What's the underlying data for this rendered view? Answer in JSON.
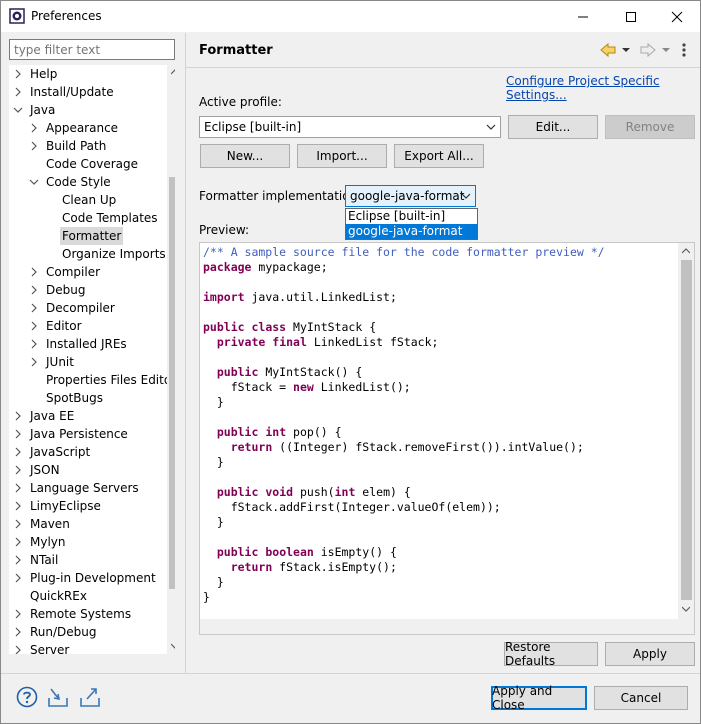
{
  "window": {
    "title": "Preferences"
  },
  "left": {
    "filter_placeholder": "type filter text",
    "tree": [
      {
        "label": "Help",
        "level": 0,
        "twisty": "closed"
      },
      {
        "label": "Install/Update",
        "level": 0,
        "twisty": "closed"
      },
      {
        "label": "Java",
        "level": 0,
        "twisty": "open"
      },
      {
        "label": "Appearance",
        "level": 1,
        "twisty": "closed"
      },
      {
        "label": "Build Path",
        "level": 1,
        "twisty": "closed"
      },
      {
        "label": "Code Coverage",
        "level": 1,
        "twisty": "none"
      },
      {
        "label": "Code Style",
        "level": 1,
        "twisty": "open"
      },
      {
        "label": "Clean Up",
        "level": 2,
        "twisty": "none"
      },
      {
        "label": "Code Templates",
        "level": 2,
        "twisty": "none"
      },
      {
        "label": "Formatter",
        "level": 2,
        "twisty": "none",
        "selected": true
      },
      {
        "label": "Organize Imports",
        "level": 2,
        "twisty": "none"
      },
      {
        "label": "Compiler",
        "level": 1,
        "twisty": "closed"
      },
      {
        "label": "Debug",
        "level": 1,
        "twisty": "closed"
      },
      {
        "label": "Decompiler",
        "level": 1,
        "twisty": "closed"
      },
      {
        "label": "Editor",
        "level": 1,
        "twisty": "closed"
      },
      {
        "label": "Installed JREs",
        "level": 1,
        "twisty": "closed"
      },
      {
        "label": "JUnit",
        "level": 1,
        "twisty": "closed"
      },
      {
        "label": "Properties Files Editor",
        "level": 1,
        "twisty": "none"
      },
      {
        "label": "SpotBugs",
        "level": 1,
        "twisty": "none"
      },
      {
        "label": "Java EE",
        "level": 0,
        "twisty": "closed"
      },
      {
        "label": "Java Persistence",
        "level": 0,
        "twisty": "closed"
      },
      {
        "label": "JavaScript",
        "level": 0,
        "twisty": "closed"
      },
      {
        "label": "JSON",
        "level": 0,
        "twisty": "closed"
      },
      {
        "label": "Language Servers",
        "level": 0,
        "twisty": "closed"
      },
      {
        "label": "LimyEclipse",
        "level": 0,
        "twisty": "closed"
      },
      {
        "label": "Maven",
        "level": 0,
        "twisty": "closed"
      },
      {
        "label": "Mylyn",
        "level": 0,
        "twisty": "closed"
      },
      {
        "label": "NTail",
        "level": 0,
        "twisty": "closed"
      },
      {
        "label": "Plug-in Development",
        "level": 0,
        "twisty": "closed"
      },
      {
        "label": "QuickREx",
        "level": 0,
        "twisty": "none"
      },
      {
        "label": "Remote Systems",
        "level": 0,
        "twisty": "closed"
      },
      {
        "label": "Run/Debug",
        "level": 0,
        "twisty": "closed"
      },
      {
        "label": "Server",
        "level": 0,
        "twisty": "closed"
      }
    ]
  },
  "page": {
    "title": "Formatter",
    "configure_link": "Configure Project Specific Settings...",
    "active_profile_label": "Active profile:",
    "active_profile_value": "Eclipse [built-in]",
    "edit_label": "Edit...",
    "remove_label": "Remove",
    "new_label": "New...",
    "import_label": "Import...",
    "export_label": "Export All...",
    "impl_label": "Formatter implementation:",
    "impl_value": "google-java-format",
    "impl_options": [
      "Eclipse [built-in]",
      "google-java-format"
    ],
    "preview_label": "Preview:",
    "restore_label": "Restore Defaults",
    "apply_label": "Apply"
  },
  "code_lines": [
    [
      [
        "cm",
        "/** A sample source file for the code formatter preview */"
      ]
    ],
    [
      [
        "kw",
        "package"
      ],
      [
        "",
        " mypackage;"
      ]
    ],
    [],
    [
      [
        "kw",
        "import"
      ],
      [
        "",
        " java.util.LinkedList;"
      ]
    ],
    [],
    [
      [
        "kw",
        "public"
      ],
      [
        "",
        " "
      ],
      [
        "kw",
        "class"
      ],
      [
        "",
        " MyIntStack {"
      ]
    ],
    [
      [
        "",
        "  "
      ],
      [
        "kw",
        "private"
      ],
      [
        "",
        " "
      ],
      [
        "kw",
        "final"
      ],
      [
        "",
        " LinkedList fStack;"
      ]
    ],
    [],
    [
      [
        "",
        "  "
      ],
      [
        "kw",
        "public"
      ],
      [
        "",
        " MyIntStack() {"
      ]
    ],
    [
      [
        "",
        "    fStack = "
      ],
      [
        "kw",
        "new"
      ],
      [
        "",
        " LinkedList();"
      ]
    ],
    [
      [
        "",
        "  }"
      ]
    ],
    [],
    [
      [
        "",
        "  "
      ],
      [
        "kw",
        "public"
      ],
      [
        "",
        " "
      ],
      [
        "kw",
        "int"
      ],
      [
        "",
        " pop() {"
      ]
    ],
    [
      [
        "",
        "    "
      ],
      [
        "kw",
        "return"
      ],
      [
        "",
        " ((Integer) fStack.removeFirst()).intValue();"
      ]
    ],
    [
      [
        "",
        "  }"
      ]
    ],
    [],
    [
      [
        "",
        "  "
      ],
      [
        "kw",
        "public"
      ],
      [
        "",
        " "
      ],
      [
        "kw",
        "void"
      ],
      [
        "",
        " push("
      ],
      [
        "kw",
        "int"
      ],
      [
        "",
        " elem) {"
      ]
    ],
    [
      [
        "",
        "    fStack.addFirst(Integer.valueOf(elem));"
      ]
    ],
    [
      [
        "",
        "  }"
      ]
    ],
    [],
    [
      [
        "",
        "  "
      ],
      [
        "kw",
        "public"
      ],
      [
        "",
        " "
      ],
      [
        "kw",
        "boolean"
      ],
      [
        "",
        " isEmpty() {"
      ]
    ],
    [
      [
        "",
        "    "
      ],
      [
        "kw",
        "return"
      ],
      [
        "",
        " fStack.isEmpty();"
      ]
    ],
    [
      [
        "",
        "  }"
      ]
    ],
    [
      [
        "",
        "}"
      ]
    ]
  ],
  "footer": {
    "apply_close_label": "Apply and Close",
    "cancel_label": "Cancel"
  },
  "colors": {
    "accent": "#0078d7",
    "keyword": "#7f0055",
    "comment": "#3f5fbf",
    "link": "#0645ad"
  },
  "icons": [
    "help-icon",
    "import-icon",
    "export-icon",
    "back-icon",
    "forward-icon",
    "menu-icon"
  ]
}
